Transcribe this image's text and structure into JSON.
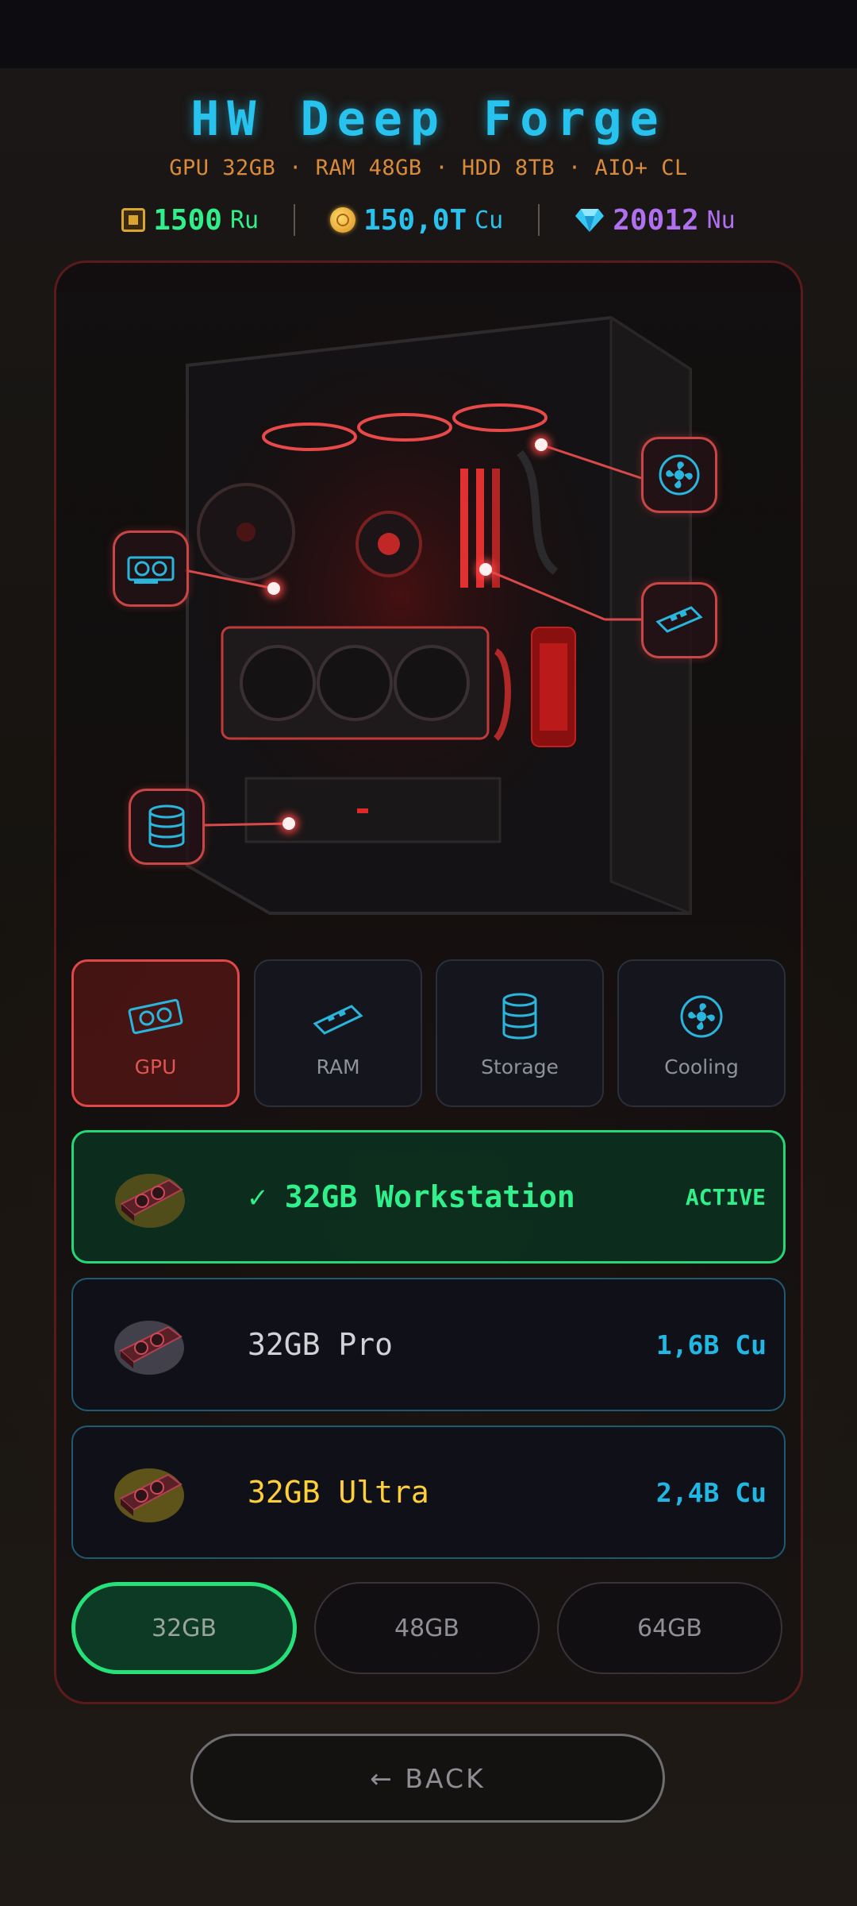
{
  "header": {
    "title": "HW Deep Forge",
    "specs": "GPU 32GB · RAM 48GB · HDD 8TB · AIO+ CL"
  },
  "currencies": [
    {
      "icon": "chip-icon",
      "value": "1500",
      "unit": "Ru",
      "color": "#2ff08a"
    },
    {
      "icon": "coin-icon",
      "value": "150,0T",
      "unit": "Cu",
      "color": "#27c3ee"
    },
    {
      "icon": "diamond-icon",
      "value": "20012",
      "unit": "Nu",
      "color": "#b070f0"
    }
  ],
  "tabs": [
    {
      "label": "GPU",
      "icon": "gpu-icon",
      "active": true
    },
    {
      "label": "RAM",
      "icon": "ram-icon",
      "active": false
    },
    {
      "label": "Storage",
      "icon": "storage-icon",
      "active": false
    },
    {
      "label": "Cooling",
      "icon": "fan-icon",
      "active": false
    }
  ],
  "items": [
    {
      "name": "✓ 32GB Workstation",
      "price": "ACTIVE",
      "active": true,
      "name_color": "#2ff08a"
    },
    {
      "name": "32GB Pro",
      "price": "1,6B Cu",
      "active": false,
      "name_color": "#d0d2d6"
    },
    {
      "name": "32GB Ultra",
      "price": "2,4B Cu",
      "active": false,
      "name_color": "#ffcf3a"
    }
  ],
  "sizes": [
    {
      "label": "32GB",
      "active": true
    },
    {
      "label": "48GB",
      "active": false
    },
    {
      "label": "64GB",
      "active": false
    }
  ],
  "back_label": "← BACK",
  "colors": {
    "accent_cyan": "#27c3ee",
    "accent_green": "#26d776",
    "accent_red": "#e04848",
    "accent_orange": "#d98a3a"
  }
}
